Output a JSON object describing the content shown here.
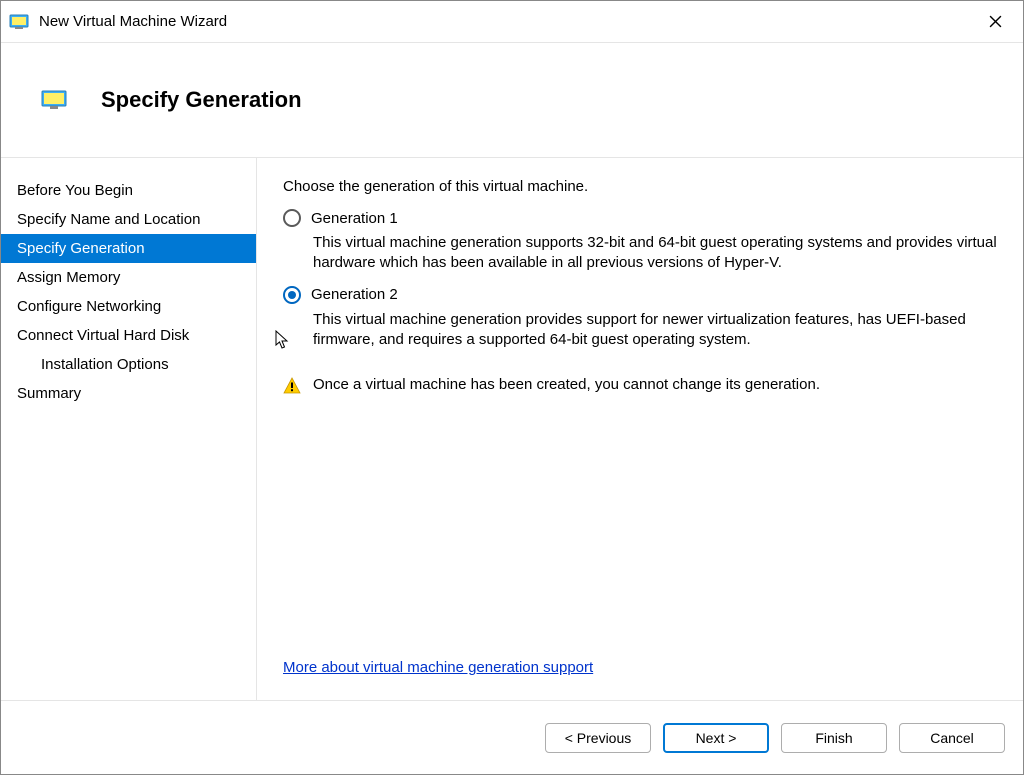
{
  "window": {
    "title": "New Virtual Machine Wizard"
  },
  "header": {
    "title": "Specify Generation"
  },
  "sidebar": {
    "items": [
      {
        "label": "Before You Begin",
        "active": false,
        "indent": false
      },
      {
        "label": "Specify Name and Location",
        "active": false,
        "indent": false
      },
      {
        "label": "Specify Generation",
        "active": true,
        "indent": false
      },
      {
        "label": "Assign Memory",
        "active": false,
        "indent": false
      },
      {
        "label": "Configure Networking",
        "active": false,
        "indent": false
      },
      {
        "label": "Connect Virtual Hard Disk",
        "active": false,
        "indent": false
      },
      {
        "label": "Installation Options",
        "active": false,
        "indent": true
      },
      {
        "label": "Summary",
        "active": false,
        "indent": false
      }
    ]
  },
  "content": {
    "intro": "Choose the generation of this virtual machine.",
    "options": [
      {
        "label": "Generation 1",
        "selected": false,
        "description": "This virtual machine generation supports 32-bit and 64-bit guest operating systems and provides virtual hardware which has been available in all previous versions of Hyper-V."
      },
      {
        "label": "Generation 2",
        "selected": true,
        "description": "This virtual machine generation provides support for newer virtualization features, has UEFI-based firmware, and requires a supported 64-bit guest operating system."
      }
    ],
    "warning": "Once a virtual machine has been created, you cannot change its generation.",
    "help_link": "More about virtual machine generation support"
  },
  "footer": {
    "previous": "< Previous",
    "next": "Next >",
    "finish": "Finish",
    "cancel": "Cancel"
  }
}
